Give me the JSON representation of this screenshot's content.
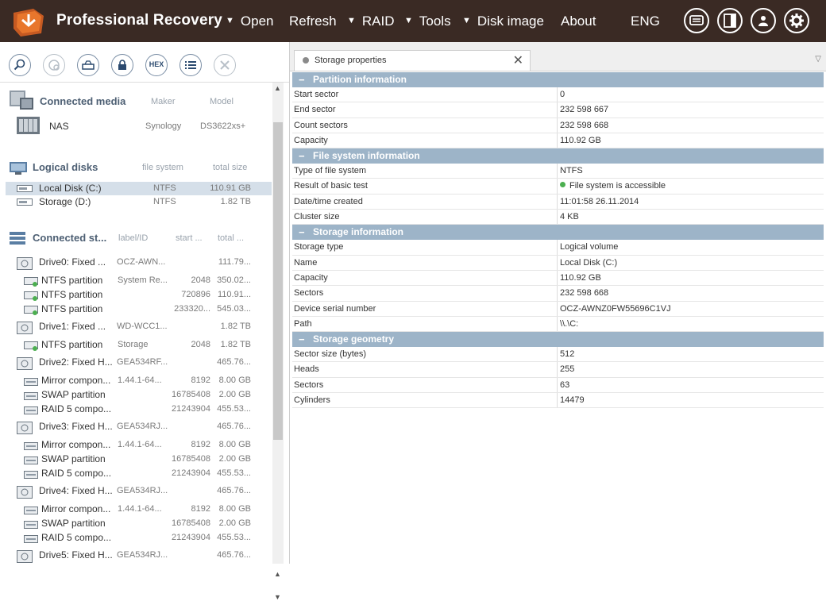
{
  "app": {
    "title": "Professional Recovery",
    "menu": [
      {
        "label": "Open",
        "has_arrow": true
      },
      {
        "label": "Refresh",
        "has_arrow": false
      },
      {
        "label": "RAID",
        "has_arrow": true
      },
      {
        "label": "Tools",
        "has_arrow": true
      },
      {
        "label": "Disk image",
        "has_arrow": true
      },
      {
        "label": "About",
        "has_arrow": false
      },
      {
        "label": "ENG",
        "has_arrow": false
      }
    ],
    "top_icons": [
      "chat-icon",
      "panel-icon",
      "user-icon",
      "gear-icon"
    ],
    "colors": {
      "topbar": "#3a2a24",
      "accent": "#e8762c",
      "group_header": "#9db4c8",
      "selection": "#d5dfe9"
    }
  },
  "toolbar": {
    "buttons": [
      "search-icon",
      "scan-icon",
      "drive-icon",
      "lock-icon",
      "hex-icon",
      "list-icon",
      "close-icon"
    ],
    "hex_label": "HEX"
  },
  "connected_media": {
    "title": "Connected media",
    "cols": {
      "maker": "Maker",
      "model": "Model"
    },
    "items": [
      {
        "name": "NAS",
        "maker": "Synology",
        "model": "DS3622xs+"
      }
    ]
  },
  "logical_disks": {
    "title": "Logical disks",
    "cols": {
      "fs": "file system",
      "size": "total size"
    },
    "items": [
      {
        "name": "Local Disk (C:)",
        "fs": "NTFS",
        "size": "110.91 GB",
        "selected": true
      },
      {
        "name": "Storage (D:)",
        "fs": "NTFS",
        "size": "1.82 TB",
        "selected": false
      }
    ]
  },
  "connected_storages": {
    "title": "Connected st...",
    "cols": {
      "label": "label/ID",
      "start": "start ...",
      "total": "total ..."
    },
    "items": [
      {
        "kind": "drive",
        "name": "Drive0: Fixed ...",
        "label": "OCZ-AWN...",
        "start": "",
        "size": "111.79..."
      },
      {
        "kind": "part",
        "name": "NTFS partition",
        "label": "System Re...",
        "start": "2048",
        "size": "350.02..."
      },
      {
        "kind": "part",
        "name": "NTFS partition",
        "label": "",
        "start": "720896",
        "size": "110.91..."
      },
      {
        "kind": "part",
        "name": "NTFS partition",
        "label": "",
        "start": "233320...",
        "size": "545.03..."
      },
      {
        "kind": "drive",
        "name": "Drive1: Fixed ...",
        "label": "WD-WCC1...",
        "start": "",
        "size": "1.82 TB"
      },
      {
        "kind": "part",
        "name": "NTFS partition",
        "label": "Storage",
        "start": "2048",
        "size": "1.82 TB"
      },
      {
        "kind": "drive",
        "name": "Drive2: Fixed H...",
        "label": "GEA534RF...",
        "start": "",
        "size": "465.76..."
      },
      {
        "kind": "raid",
        "name": "Mirror compon...",
        "label": "1.44.1-64...",
        "start": "8192",
        "size": "8.00 GB"
      },
      {
        "kind": "raid",
        "name": "SWAP partition",
        "label": "",
        "start": "16785408",
        "size": "2.00 GB"
      },
      {
        "kind": "raid",
        "name": "RAID 5 compo...",
        "label": "",
        "start": "21243904",
        "size": "455.53..."
      },
      {
        "kind": "drive",
        "name": "Drive3: Fixed H...",
        "label": "GEA534RJ...",
        "start": "",
        "size": "465.76..."
      },
      {
        "kind": "raid",
        "name": "Mirror compon...",
        "label": "1.44.1-64...",
        "start": "8192",
        "size": "8.00 GB"
      },
      {
        "kind": "raid",
        "name": "SWAP partition",
        "label": "",
        "start": "16785408",
        "size": "2.00 GB"
      },
      {
        "kind": "raid",
        "name": "RAID 5 compo...",
        "label": "",
        "start": "21243904",
        "size": "455.53..."
      },
      {
        "kind": "drive",
        "name": "Drive4: Fixed H...",
        "label": "GEA534RJ...",
        "start": "",
        "size": "465.76..."
      },
      {
        "kind": "raid",
        "name": "Mirror compon...",
        "label": "1.44.1-64...",
        "start": "8192",
        "size": "8.00 GB"
      },
      {
        "kind": "raid",
        "name": "SWAP partition",
        "label": "",
        "start": "16785408",
        "size": "2.00 GB"
      },
      {
        "kind": "raid",
        "name": "RAID 5 compo...",
        "label": "",
        "start": "21243904",
        "size": "455.53..."
      },
      {
        "kind": "drive",
        "name": "Drive5: Fixed H...",
        "label": "GEA534RJ...",
        "start": "",
        "size": "465.76..."
      }
    ]
  },
  "tab": {
    "label": "Storage properties"
  },
  "groups": [
    {
      "title": "Partition information",
      "rows": [
        {
          "k": "Start sector",
          "v": "0"
        },
        {
          "k": "End sector",
          "v": "232 598 667"
        },
        {
          "k": "Count sectors",
          "v": "232 598 668"
        },
        {
          "k": "Capacity",
          "v": "110.92 GB"
        }
      ]
    },
    {
      "title": "File system information",
      "rows": [
        {
          "k": "Type of file system",
          "v": "NTFS"
        },
        {
          "k": "Result of basic test",
          "v": "File system is accessible",
          "status": "ok"
        },
        {
          "k": "Date/time created",
          "v": "11:01:58 26.11.2014"
        },
        {
          "k": "Cluster size",
          "v": "4 KB"
        }
      ]
    },
    {
      "title": "Storage information",
      "rows": [
        {
          "k": "Storage type",
          "v": "Logical volume"
        },
        {
          "k": "Name",
          "v": "Local Disk (C:)"
        },
        {
          "k": "Capacity",
          "v": "110.92 GB"
        },
        {
          "k": "Sectors",
          "v": "232 598 668"
        },
        {
          "k": "Device serial number",
          "v": "OCZ-AWNZ0FW55696C1VJ"
        },
        {
          "k": "Path",
          "v": "\\\\.\\C:"
        }
      ]
    },
    {
      "title": "Storage geometry",
      "rows": [
        {
          "k": "Sector size (bytes)",
          "v": "512"
        },
        {
          "k": "Heads",
          "v": "255"
        },
        {
          "k": "Sectors",
          "v": "63"
        },
        {
          "k": "Cylinders",
          "v": "14479"
        }
      ]
    }
  ]
}
